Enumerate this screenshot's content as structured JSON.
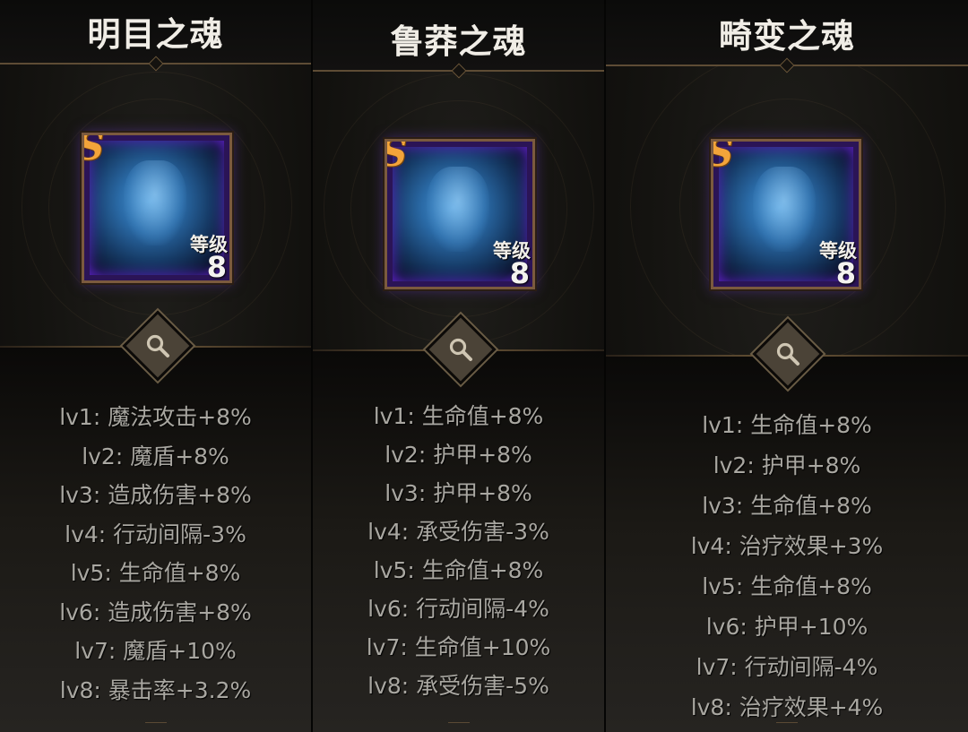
{
  "panels": [
    {
      "title": "明目之魂",
      "grade": "S",
      "level_label": "等级",
      "level": "8",
      "stats": [
        "lv1: 魔法攻击+8%",
        "lv2: 魔盾+8%",
        "lv3: 造成伤害+8%",
        "lv4: 行动间隔-3%",
        "lv5: 生命值+8%",
        "lv6: 造成伤害+8%",
        "lv7: 魔盾+10%",
        "lv8: 暴击率+3.2%"
      ]
    },
    {
      "title": "鲁莽之魂",
      "grade": "S",
      "level_label": "等级",
      "level": "8",
      "stats": [
        "lv1: 生命值+8%",
        "lv2: 护甲+8%",
        "lv3: 护甲+8%",
        "lv4: 承受伤害-3%",
        "lv5: 生命值+8%",
        "lv6: 行动间隔-4%",
        "lv7: 生命值+10%",
        "lv8: 承受伤害-5%"
      ]
    },
    {
      "title": "畸变之魂",
      "grade": "S",
      "level_label": "等级",
      "level": "8",
      "stats": [
        "lv1: 生命值+8%",
        "lv2: 护甲+8%",
        "lv3: 生命值+8%",
        "lv4: 治疗效果+3%",
        "lv5: 生命值+8%",
        "lv6: 护甲+10%",
        "lv7: 行动间隔-4%",
        "lv8: 治疗效果+4%"
      ]
    }
  ],
  "icons": {
    "inspect": "magnifier-icon",
    "portrait": "soul-portrait"
  },
  "colors": {
    "grade": "#f3a43a",
    "card_frame": "#7b5a3e",
    "card_glow": "#5a22c2",
    "stat_text": "#a9a7a1",
    "title_text": "#f0ede6"
  }
}
